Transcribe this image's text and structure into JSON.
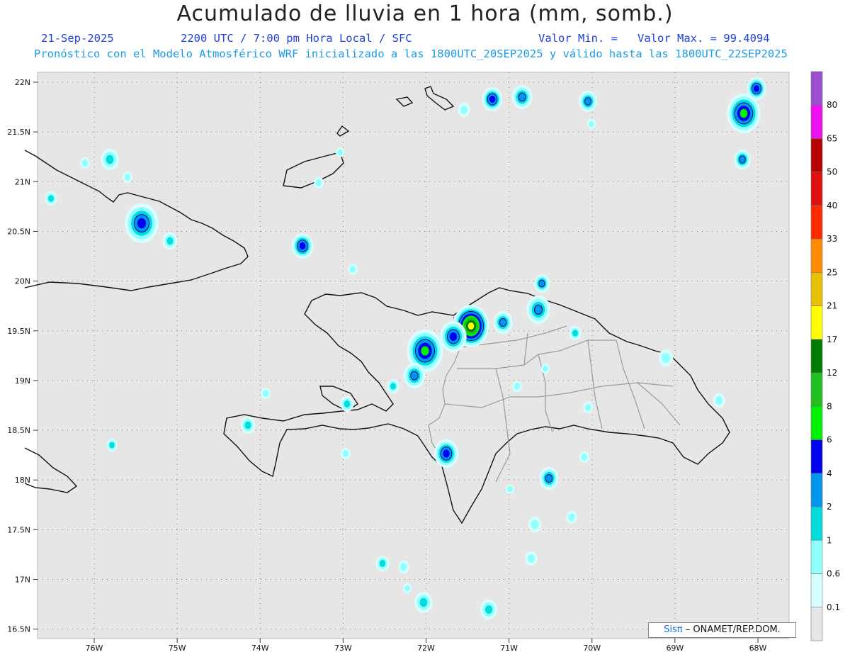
{
  "header": {
    "title": "Acumulado de lluvia en 1 hora (mm, somb.)",
    "date": "21-Sep-2025",
    "valid_time": "2200 UTC / 7:00 pm Hora Local / SFC",
    "valor_min": "Valor Min. =",
    "valor_max": "Valor Max. = 99.4094",
    "model_info": "Pronóstico con el Modelo Atmosférico WRF inicializado a las 1800UTC_20SEP2025 y válido hasta las  1800UTC_22SEP2025"
  },
  "axes": {
    "lat_labels": [
      "22N",
      "21.5N",
      "21N",
      "20.5N",
      "20N",
      "19.5N",
      "19N",
      "18.5N",
      "18N",
      "17.5N",
      "17N",
      "16.5N"
    ],
    "lon_labels": [
      "76W",
      "75W",
      "74W",
      "73W",
      "72W",
      "71W",
      "70W",
      "69W",
      "68W"
    ],
    "lat_values": [
      22,
      21.5,
      21,
      20.5,
      20,
      19.5,
      19,
      18.5,
      18,
      17.5,
      17,
      16.5
    ],
    "lon_values": [
      -76,
      -75,
      -74,
      -73,
      -72,
      -71,
      -70,
      -69,
      -68
    ]
  },
  "colorbar": {
    "labels": [
      "80",
      "65",
      "50",
      "40",
      "33",
      "25",
      "21",
      "17",
      "12",
      "8",
      "6",
      "4",
      "2",
      "1",
      "0.6",
      "0.1"
    ],
    "colors": [
      "#9a4fcf",
      "#ee10ee",
      "#b40000",
      "#e01010",
      "#ff2a00",
      "#ff8c00",
      "#e8c000",
      "#ffff00",
      "#007d00",
      "#20c020",
      "#00f000",
      "#0000f0",
      "#0096f0",
      "#00dcdc",
      "#90ffff",
      "#d8ffff",
      "#e6e6e6"
    ]
  },
  "credit": {
    "brand": "Sisπ",
    "text": "– ONAMET/REP.DOM."
  }
}
